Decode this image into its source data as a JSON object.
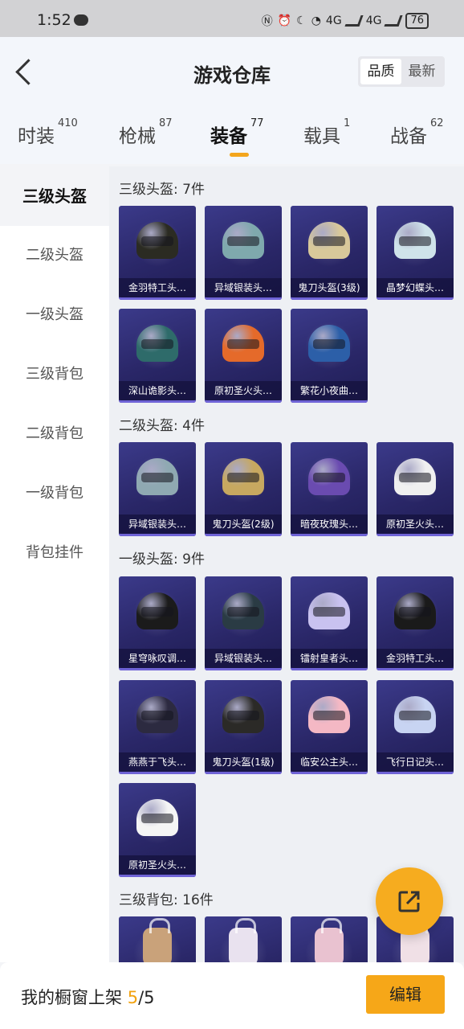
{
  "status_bar": {
    "time": "1:52",
    "battery": "76",
    "net1": "4G",
    "net2": "4G"
  },
  "header": {
    "title": "游戏仓库",
    "sort_options": [
      "品质",
      "最新"
    ]
  },
  "tabs": [
    {
      "label": "时装",
      "count": "410"
    },
    {
      "label": "枪械",
      "count": "87"
    },
    {
      "label": "装备",
      "count": "77"
    },
    {
      "label": "载具",
      "count": "1"
    },
    {
      "label": "战备",
      "count": "62"
    }
  ],
  "sidebar": [
    "三级头盔",
    "二级头盔",
    "一级头盔",
    "三级背包",
    "二级背包",
    "一级背包",
    "背包挂件"
  ],
  "sections": [
    {
      "title": "三级头盔: 7件",
      "items": [
        "金羽特工头…",
        "异域银装头…",
        "鬼刀头盔(3级)",
        "晶梦幻蝶头…",
        "深山诡影头…",
        "原初圣火头…",
        "繁花小夜曲…"
      ]
    },
    {
      "title": "二级头盔: 4件",
      "items": [
        "异域银装头…",
        "鬼刀头盔(2级)",
        "暗夜玫瑰头…",
        "原初圣火头…"
      ]
    },
    {
      "title": "一级头盔: 9件",
      "items": [
        "星穹咏叹调…",
        "异域银装头…",
        "镭射皇者头…",
        "金羽特工头…",
        "燕燕于飞头…",
        "鬼刀头盔(1级)",
        "临安公主头…",
        "飞行日记头…",
        "原初圣火头…"
      ]
    },
    {
      "title": "三级背包: 16件",
      "items": [
        "",
        "",
        "",
        ""
      ]
    }
  ],
  "colors": {
    "accent": "#f6a718",
    "helmets": [
      "#2b2b22",
      "#7fa9ad",
      "#d8c89a",
      "#cfe3ea",
      "#2e6b6a",
      "#e56a2a",
      "#2c5fa8",
      "#8fa9b2",
      "#c7a860",
      "#6a4bb0",
      "#f0f0f0",
      "#1b1b1b",
      "#2a3b44",
      "#c9c2f0",
      "#1a1a1a",
      "#2c2a40",
      "#2b2a27",
      "#f4b8c4",
      "#c8d4f2",
      "#f5f5f5"
    ],
    "backpacks": [
      "#c9a27a",
      "#e9e2ef",
      "#e9c2d0",
      "#f0e0e6"
    ]
  },
  "bottom": {
    "label": "我的橱窗上架 ",
    "current": "5",
    "total": "/5",
    "edit": "编辑"
  }
}
